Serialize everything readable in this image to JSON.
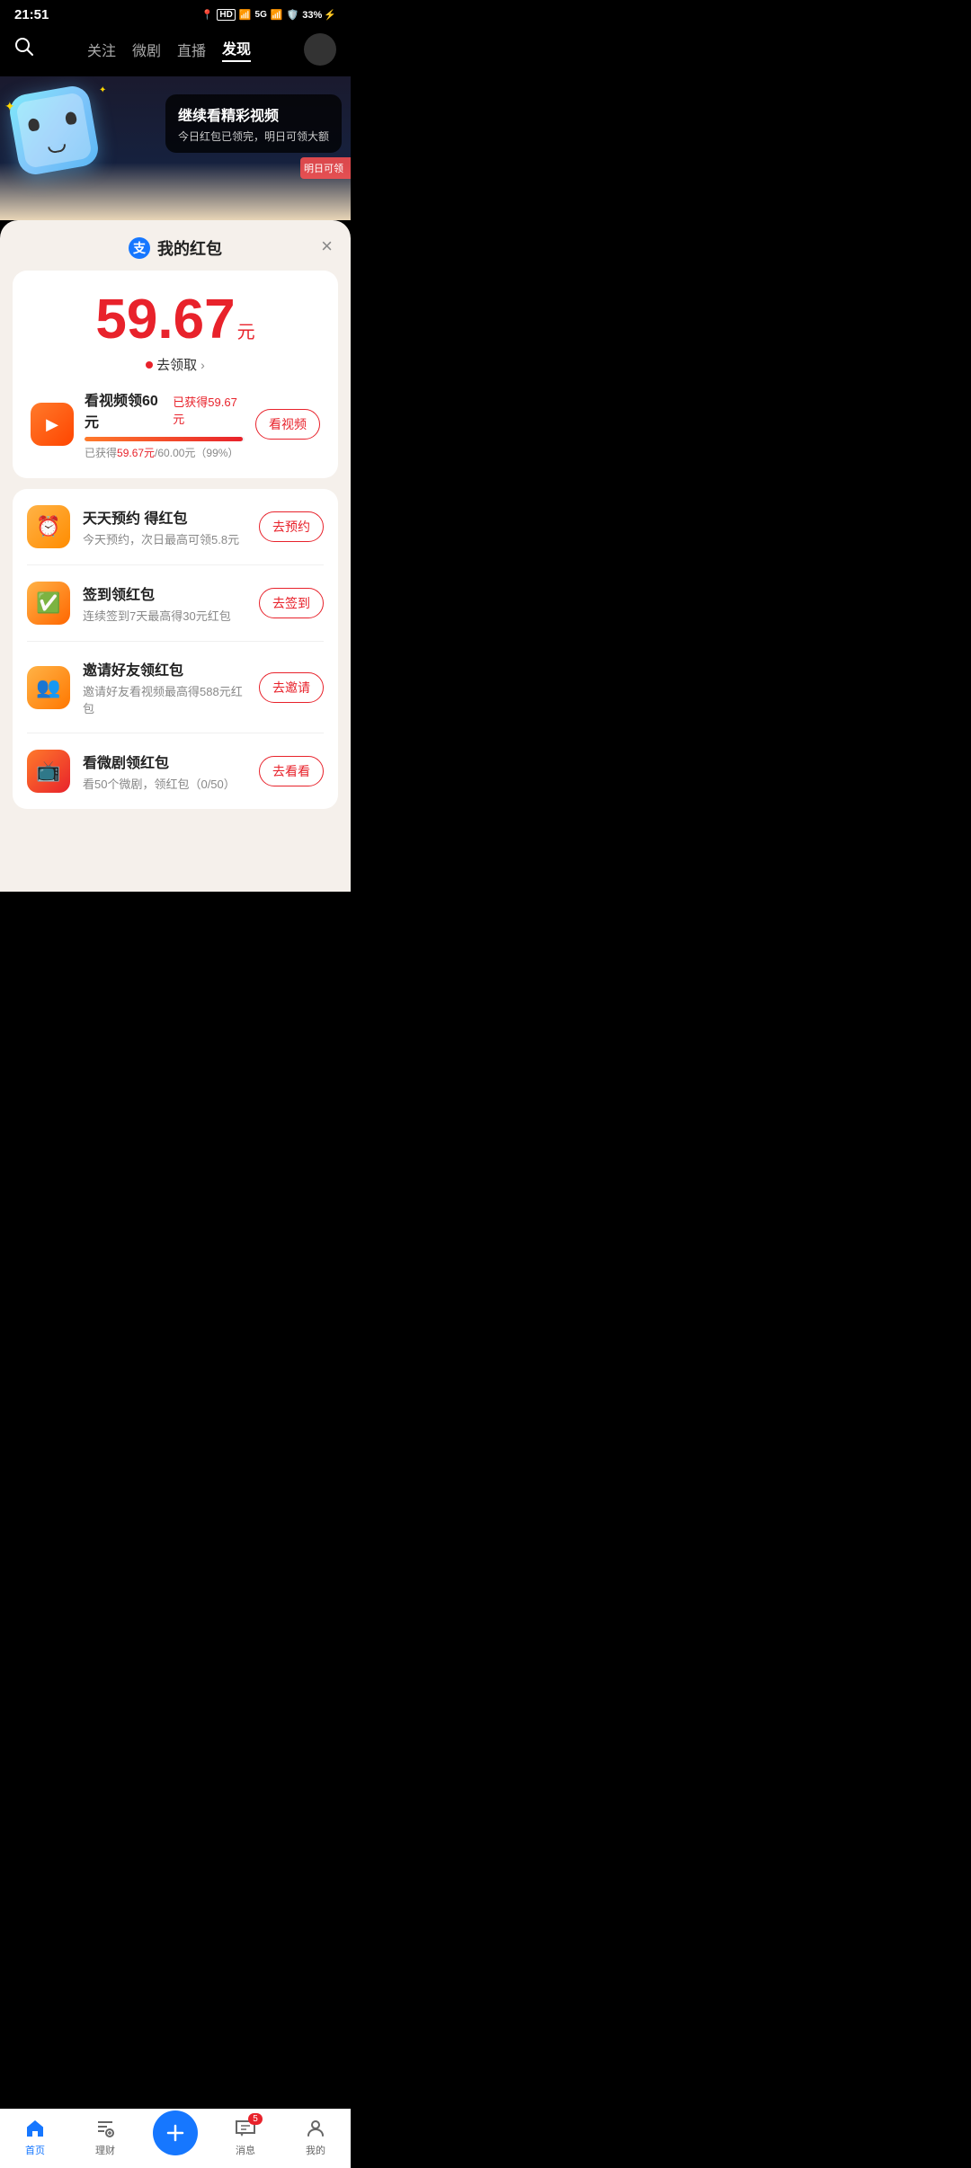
{
  "statusBar": {
    "time": "21:51",
    "battery": "33%"
  },
  "nav": {
    "tabs": [
      {
        "label": "关注",
        "active": false
      },
      {
        "label": "微剧",
        "active": false
      },
      {
        "label": "直播",
        "active": false
      },
      {
        "label": "发现",
        "active": true
      }
    ]
  },
  "banner": {
    "title": "继续看精彩视频",
    "subtitle": "今日红包已领完，明日可领大额",
    "tag": "明日可领"
  },
  "modal": {
    "title": "我的红包",
    "alipayChar": "支",
    "amount": "59.67",
    "amountUnit": "元",
    "collectText": "去领取",
    "closeLabel": "×"
  },
  "taskCard": {
    "title": "看视频领60元",
    "earnedLabel": "已获得",
    "earnedAmount": "59.67元",
    "progressPercent": 99,
    "subText1": "已获得",
    "subAmount": "59.67元",
    "subText2": "/60.00元（99%）",
    "btnLabel": "看视频"
  },
  "listItems": [
    {
      "id": "reserve",
      "iconType": "clock",
      "iconEmoji": "⏰",
      "title": "天天预约 得红包",
      "subtitle": "今天预约，次日最高可领5.8元",
      "btnLabel": "去预约"
    },
    {
      "id": "checkin",
      "iconType": "check",
      "iconEmoji": "✅",
      "title": "签到领红包",
      "subtitle": "连续签到7天最高得30元红包",
      "btnLabel": "去签到"
    },
    {
      "id": "invite",
      "iconType": "invite",
      "iconEmoji": "👤",
      "title": "邀请好友领红包",
      "subtitle": "邀请好友看视频最高得588元红包",
      "btnLabel": "去邀请"
    },
    {
      "id": "micro",
      "iconType": "micro",
      "iconEmoji": "📺",
      "title": "看微剧领红包",
      "subtitle": "看50个微剧，领红包（0/50）",
      "btnLabel": "去看看"
    }
  ],
  "bottomNav": {
    "items": [
      {
        "id": "home",
        "label": "首页",
        "active": true,
        "icon": "⊙"
      },
      {
        "id": "finance",
        "label": "理财",
        "active": false,
        "icon": "♦"
      },
      {
        "id": "plus",
        "label": "",
        "active": false,
        "icon": "+"
      },
      {
        "id": "message",
        "label": "消息",
        "active": false,
        "icon": "💬",
        "badge": "5"
      },
      {
        "id": "mine",
        "label": "我的",
        "active": false,
        "icon": "👤"
      }
    ]
  }
}
